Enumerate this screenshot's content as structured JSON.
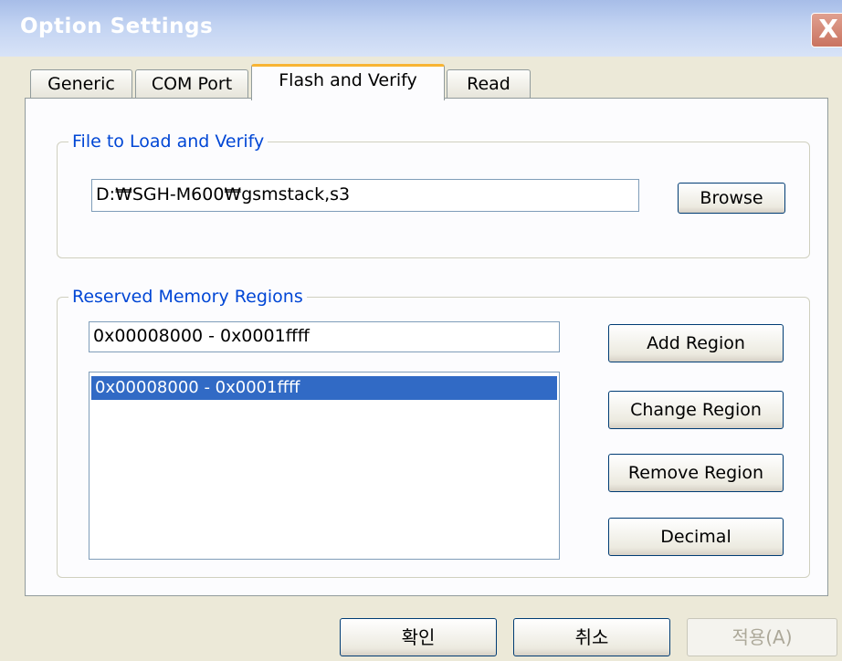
{
  "window": {
    "title": "Option Settings",
    "close_glyph": "X"
  },
  "tabs": [
    {
      "label": "Generic",
      "active": false
    },
    {
      "label": "COM Port",
      "active": false
    },
    {
      "label": "Flash and Verify",
      "active": true
    },
    {
      "label": "Read",
      "active": false
    }
  ],
  "file_group": {
    "title": "File to Load and Verify",
    "path_value": "D:₩SGH-M600₩gsmstack,s3",
    "browse_label": "Browse"
  },
  "memory_group": {
    "title": "Reserved Memory Regions",
    "region_input_value": "0x00008000 - 0x0001ffff",
    "regions": [
      "0x00008000 - 0x0001ffff"
    ],
    "selected_region_index": 0,
    "add_label": "Add Region",
    "change_label": "Change Region",
    "remove_label": "Remove Region",
    "decimal_label": "Decimal"
  },
  "dialog_buttons": {
    "ok_label": "확인",
    "cancel_label": "취소",
    "apply_label": "적용(A)",
    "apply_enabled": false
  },
  "colors": {
    "group_title": "#0046d5",
    "active_tab_accent": "#f8b433",
    "selection": "#316ac5",
    "title_bar": "#a7bde8"
  }
}
